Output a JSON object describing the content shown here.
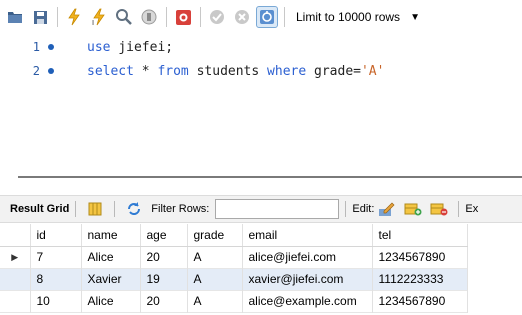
{
  "toolbar": {
    "buttons": [
      {
        "icon": "open-folder-icon"
      },
      {
        "icon": "save-icon"
      },
      {
        "icon": "execute-icon"
      },
      {
        "icon": "execute-current-icon"
      },
      {
        "icon": "explain-icon"
      },
      {
        "icon": "stop-icon"
      },
      {
        "icon": "error-toggle-icon"
      },
      {
        "icon": "commit-icon"
      },
      {
        "icon": "rollback-icon"
      },
      {
        "icon": "autocommit-icon"
      }
    ],
    "limit_label": "Limit to 10000 rows"
  },
  "editor": {
    "lines": [
      {
        "number": "1",
        "tokens": [
          [
            "kw",
            "use"
          ],
          [
            "sp",
            " "
          ],
          [
            "id",
            "jiefei"
          ],
          [
            "pn",
            ";"
          ]
        ]
      },
      {
        "number": "2",
        "tokens": [
          [
            "kw",
            "select"
          ],
          [
            "sp",
            " "
          ],
          [
            "pn",
            "*"
          ],
          [
            "sp",
            " "
          ],
          [
            "kw",
            "from"
          ],
          [
            "sp",
            " "
          ],
          [
            "id",
            "students"
          ],
          [
            "sp",
            " "
          ],
          [
            "kw",
            "where"
          ],
          [
            "sp",
            " "
          ],
          [
            "id",
            "grade"
          ],
          [
            "pn",
            "="
          ],
          [
            "str",
            "'A'"
          ]
        ]
      }
    ]
  },
  "result_toolbar": {
    "result_grid_label": "Result Grid",
    "filter_label": "Filter Rows:",
    "filter_value": "",
    "edit_label": "Edit:",
    "export_label": "Ex"
  },
  "grid": {
    "columns": [
      "id",
      "name",
      "age",
      "grade",
      "email",
      "tel"
    ],
    "rows": [
      [
        "7",
        "Alice",
        "20",
        "A",
        "alice@jiefei.com",
        "1234567890"
      ],
      [
        "8",
        "Xavier",
        "19",
        "A",
        "xavier@jiefei.com",
        "1112223333"
      ],
      [
        "10",
        "Alice",
        "20",
        "A",
        "alice@example.com",
        "1234567890"
      ]
    ],
    "current_row_marker": "▶"
  },
  "colors": {
    "keyword": "#2b5fd1",
    "string": "#c86428",
    "line_number": "#2a5aa5",
    "alt_row": "#e4ecf7"
  }
}
